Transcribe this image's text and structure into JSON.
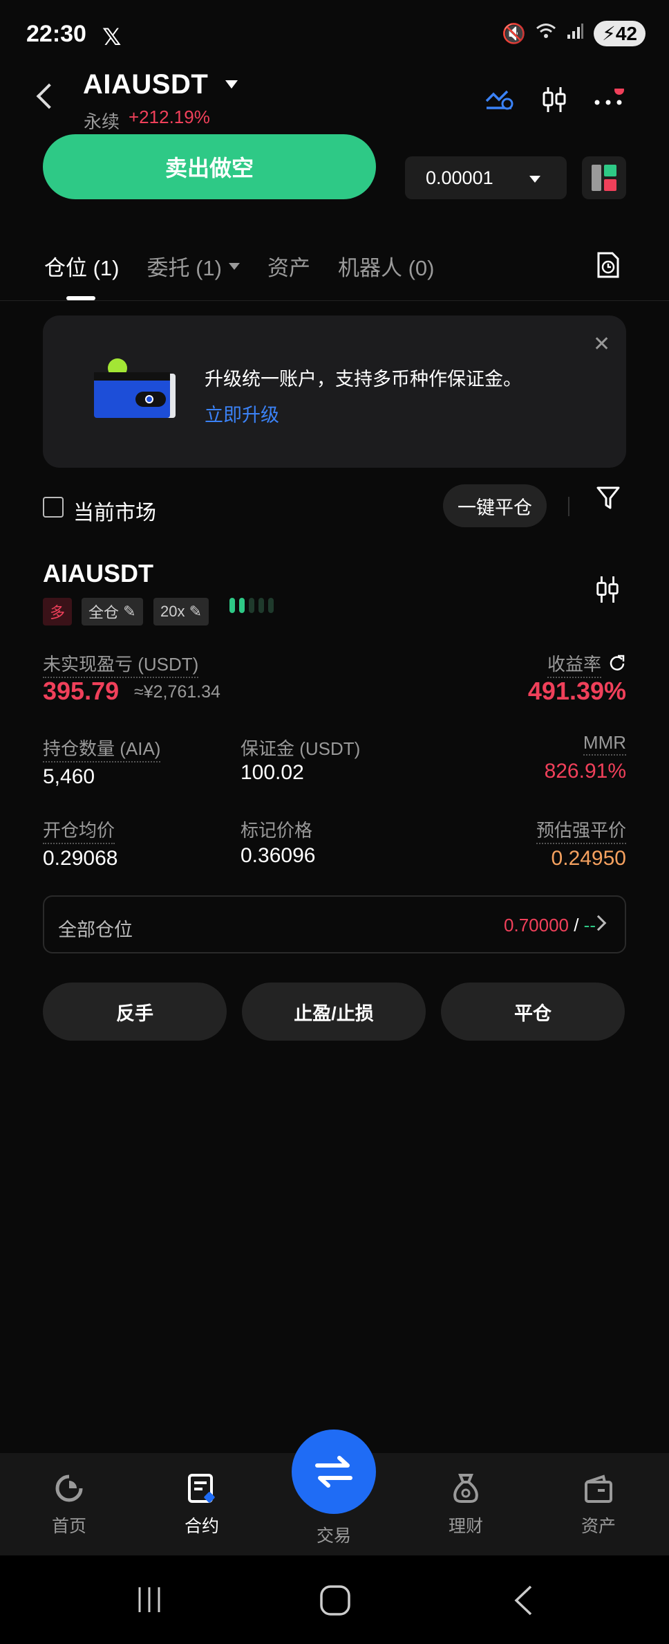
{
  "status_bar": {
    "time": "22:30",
    "battery": "42"
  },
  "header": {
    "pair": "AIAUSDT",
    "contract_type": "永续",
    "change": "+212.19%"
  },
  "trade": {
    "sell_label": "卖出做空",
    "quantity_step": "0.00001"
  },
  "tabs": [
    {
      "label": "仓位 (1)"
    },
    {
      "label": "委托 (1)"
    },
    {
      "label": "资产"
    },
    {
      "label": "机器人 (0)"
    }
  ],
  "banner": {
    "text": "升级统一账户，支持多币种作保证金。",
    "link": "立即升级"
  },
  "filter": {
    "current_market_label": "当前市场",
    "close_all_label": "一键平仓"
  },
  "position": {
    "symbol": "AIAUSDT",
    "side": "多",
    "margin_mode": "全仓",
    "leverage": "20x",
    "unrealized_pnl_label": "未实现盈亏 (USDT)",
    "unrealized_pnl": "395.79",
    "unrealized_pnl_cny": "≈¥2,761.34",
    "roi_label": "收益率",
    "roi": "491.39%",
    "size_label": "持仓数量 (AIA)",
    "size": "5,460",
    "margin_label": "保证金 (USDT)",
    "margin": "100.02",
    "mmr_label": "MMR",
    "mmr": "826.91%",
    "entry_label": "开仓均价",
    "entry": "0.29068",
    "mark_label": "标记价格",
    "mark": "0.36096",
    "liq_label": "预估强平价",
    "liq": "0.24950",
    "all_positions_label": "全部仓位",
    "all_positions_red": "0.70000",
    "all_positions_sep": " / ",
    "all_positions_green": "--",
    "btn_reverse": "反手",
    "btn_tpsl": "止盈/止损",
    "btn_close": "平仓"
  },
  "bottom_nav": [
    {
      "label": "首页"
    },
    {
      "label": "合约"
    },
    {
      "label": "交易"
    },
    {
      "label": "理财"
    },
    {
      "label": "资产"
    }
  ],
  "colors": {
    "accent_green": "#2ec986",
    "accent_red": "#f0405a",
    "accent_blue": "#1f6cf5",
    "liq_orange": "#f5a15f"
  }
}
